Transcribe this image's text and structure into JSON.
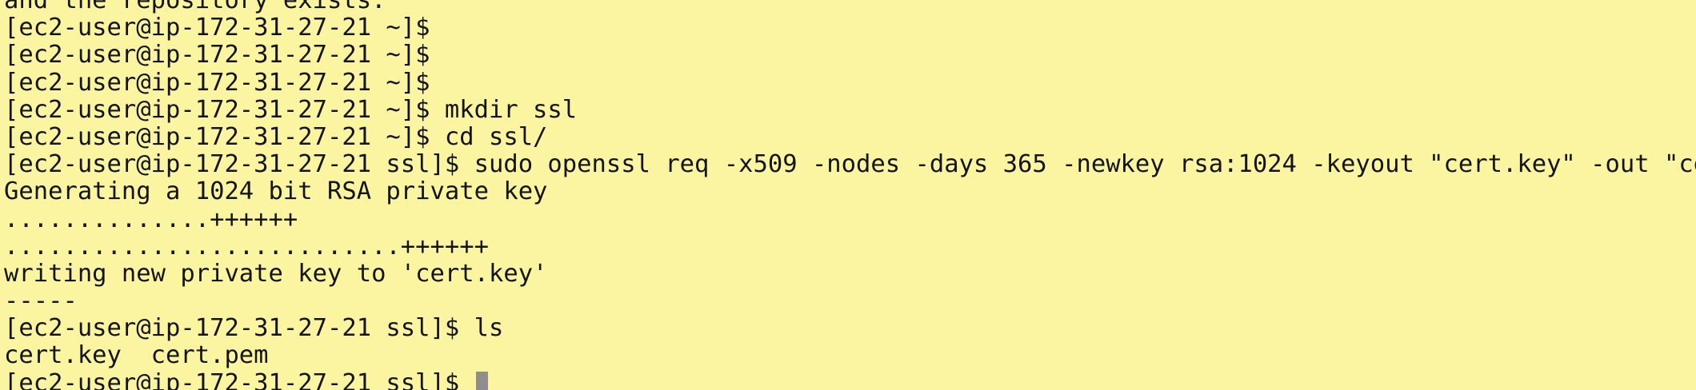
{
  "terminal": {
    "lines": [
      "and the repository exists.",
      "[ec2-user@ip-172-31-27-21 ~]$",
      "[ec2-user@ip-172-31-27-21 ~]$",
      "[ec2-user@ip-172-31-27-21 ~]$",
      "[ec2-user@ip-172-31-27-21 ~]$ mkdir ssl",
      "[ec2-user@ip-172-31-27-21 ~]$ cd ssl/",
      "[ec2-user@ip-172-31-27-21 ssl]$ sudo openssl req -x509 -nodes -days 365 -newkey rsa:1024 -keyout \"cert.key\" -out \"cert.pem\" -batch",
      "Generating a 1024 bit RSA private key",
      "..............++++++",
      "...........................++++++",
      "writing new private key to 'cert.key'",
      "-----",
      "[ec2-user@ip-172-31-27-21 ssl]$ ls",
      "cert.key  cert.pem"
    ],
    "prompt": "[ec2-user@ip-172-31-27-21 ssl]$ "
  },
  "colors": {
    "background": "#fbf5a2",
    "text": "#141414",
    "cursor": "#8e8e8e"
  }
}
